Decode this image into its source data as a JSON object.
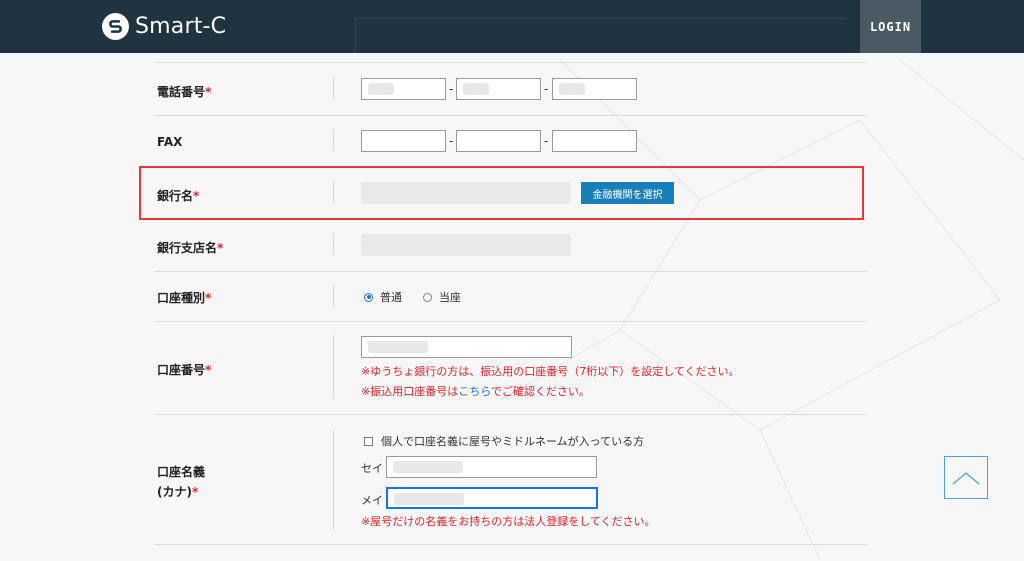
{
  "header": {
    "logo_text": "Smart-C",
    "logo_icon": "s-circle-icon",
    "login_label": "LOGIN"
  },
  "form": {
    "phone": {
      "label": "電話番号",
      "required_mark": "*",
      "separator": "-"
    },
    "fax": {
      "label": "FAX",
      "separator": "-"
    },
    "bank_name": {
      "label": "銀行名",
      "required_mark": "*",
      "select_button_label": "金融機関を選択"
    },
    "branch_name": {
      "label": "銀行支店名",
      "required_mark": "*"
    },
    "account_type": {
      "label": "口座種別",
      "required_mark": "*",
      "options": [
        {
          "label": "普通",
          "selected": true
        },
        {
          "label": "当座",
          "selected": false
        }
      ]
    },
    "account_number": {
      "label": "口座番号",
      "required_mark": "*",
      "note1": "※ゆうちょ銀行の方は、振込用の口座番号（7桁以下）を設定してください。",
      "note2_prefix": "※振込用口座番号は",
      "note2_link": "こちら",
      "note2_suffix": "でご確認ください。"
    },
    "account_holder": {
      "label_line1": "口座名義",
      "label_line2": "(カナ)",
      "required_mark": "*",
      "checkbox_label": "個人で口座名義に屋号やミドルネームが入っている方",
      "sei_label": "セイ",
      "mei_label": "メイ",
      "note": "※屋号だけの名義をお持ちの方は法人登録をしてください。"
    }
  },
  "colors": {
    "header_bg": "#1f3340",
    "login_bg": "#495a65",
    "accent_blue": "#1a7fb8",
    "required_red": "#d9262b",
    "highlight_red": "#e53935"
  },
  "scroll_top_icon": "chevron-up-icon"
}
